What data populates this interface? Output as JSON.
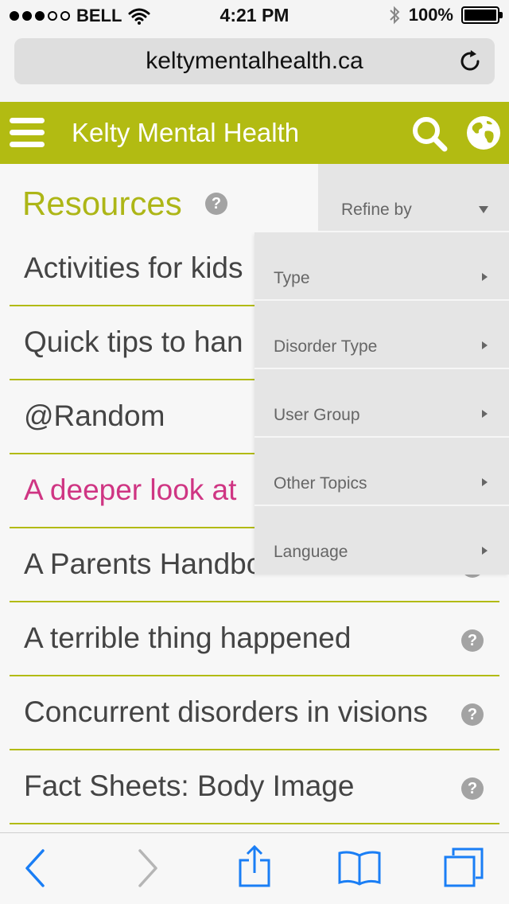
{
  "status_bar": {
    "carrier": "BELL",
    "time": "4:21 PM",
    "battery_percent": "100%",
    "signal_bars_filled": 3,
    "signal_bars_total": 5
  },
  "browser": {
    "url": "keltymentalhealth.ca"
  },
  "header": {
    "title": "Kelty Mental Health",
    "brand_color": "#b2bb12"
  },
  "content": {
    "page_title": "Resources",
    "help_glyph": "?",
    "items": [
      {
        "label": "Activities for kids"
      },
      {
        "label": "Quick tips to han"
      },
      {
        "label": "@Random"
      },
      {
        "label": "A deeper look at"
      },
      {
        "label": "A Parents Handbo"
      },
      {
        "label": "A terrible thing happened"
      },
      {
        "label": "Concurrent disorders in visions"
      },
      {
        "label": "Fact Sheets: Body Image"
      }
    ],
    "highlight_color": "#cf3583"
  },
  "refine": {
    "label": "Refine by",
    "options": [
      {
        "label": "Type"
      },
      {
        "label": "Disorder Type"
      },
      {
        "label": "User Group"
      },
      {
        "label": "Other Topics"
      },
      {
        "label": "Language"
      }
    ]
  },
  "toolbar": {
    "icons": [
      "back-icon",
      "forward-icon",
      "share-icon",
      "bookmarks-icon",
      "tabs-icon"
    ],
    "accent_color": "#1a7ef5"
  }
}
